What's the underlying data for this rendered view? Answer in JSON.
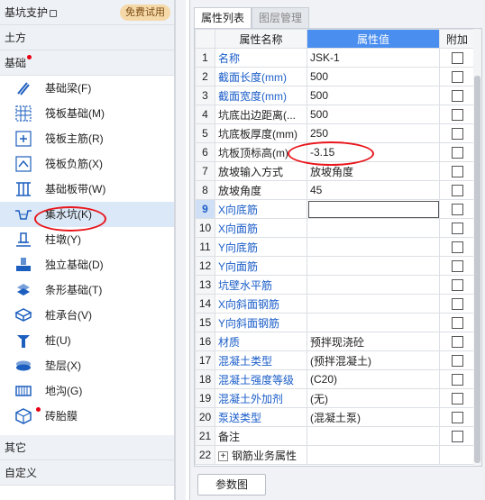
{
  "left": {
    "top_category": {
      "label": "基坑支护",
      "badge": "免费试用"
    },
    "category_earthwork": "土方",
    "category_foundation": "基础",
    "items": [
      {
        "label": "基础梁(F)"
      },
      {
        "label": "筏板基础(M)"
      },
      {
        "label": "筏板主筋(R)"
      },
      {
        "label": "筏板负筋(X)"
      },
      {
        "label": "基础板带(W)"
      },
      {
        "label": "集水坑(K)"
      },
      {
        "label": "柱墩(Y)"
      },
      {
        "label": "独立基础(D)"
      },
      {
        "label": "条形基础(T)"
      },
      {
        "label": "桩承台(V)"
      },
      {
        "label": "桩(U)"
      },
      {
        "label": "垫层(X)"
      },
      {
        "label": "地沟(G)"
      },
      {
        "label": "砖胎膜"
      }
    ],
    "category_other": "其它",
    "category_custom": "自定义"
  },
  "tabs": [
    "属性列表",
    "图层管理"
  ],
  "grid": {
    "headers": [
      "属性名称",
      "属性值",
      "附加"
    ],
    "rows": [
      {
        "num": "1",
        "name": "名称",
        "value": "JSK-1"
      },
      {
        "num": "2",
        "name": "截面长度(mm)",
        "value": "500"
      },
      {
        "num": "3",
        "name": "截面宽度(mm)",
        "value": "500"
      },
      {
        "num": "4",
        "name": "坑底出边距离(...",
        "value": "500"
      },
      {
        "num": "5",
        "name": "坑底板厚度(mm)",
        "value": "250"
      },
      {
        "num": "6",
        "name": "坑板顶标高(m)",
        "value": "-3.15"
      },
      {
        "num": "7",
        "name": "放坡输入方式",
        "value": "放坡角度"
      },
      {
        "num": "8",
        "name": "放坡角度",
        "value": "45"
      },
      {
        "num": "9",
        "name": "X向底筋",
        "value": ""
      },
      {
        "num": "10",
        "name": "X向面筋",
        "value": ""
      },
      {
        "num": "11",
        "name": "Y向底筋",
        "value": ""
      },
      {
        "num": "12",
        "name": "Y向面筋",
        "value": ""
      },
      {
        "num": "13",
        "name": "坑壁水平筋",
        "value": ""
      },
      {
        "num": "14",
        "name": "X向斜面钢筋",
        "value": ""
      },
      {
        "num": "15",
        "name": "Y向斜面钢筋",
        "value": ""
      },
      {
        "num": "16",
        "name": "材质",
        "value": "预拌现浇砼"
      },
      {
        "num": "17",
        "name": "混凝土类型",
        "value": "(预拌混凝土)"
      },
      {
        "num": "18",
        "name": "混凝土强度等级",
        "value": "(C20)"
      },
      {
        "num": "19",
        "name": "混凝土外加剂",
        "value": "(无)"
      },
      {
        "num": "20",
        "name": "泵送类型",
        "value": "(混凝土泵)"
      },
      {
        "num": "21",
        "name": "备注",
        "value": ""
      },
      {
        "num": "22",
        "name": "钢筋业务属性",
        "value": ""
      }
    ]
  },
  "param_button": "参数图",
  "colors": {
    "accent": "#4a8ef0",
    "link": "#1a5dc8",
    "highlight": "#e8151b",
    "selected": "#dbe8f7"
  }
}
